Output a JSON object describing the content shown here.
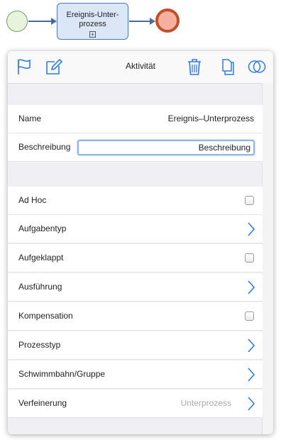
{
  "diagram": {
    "subprocess_label": "Ereignis-Unter-\nprozess",
    "subprocess_marker": "+"
  },
  "header": {
    "title": "Aktivität",
    "icons": [
      "flag-icon",
      "edit-icon",
      "trash-icon",
      "copy-icon",
      "circles-icon"
    ]
  },
  "colors": {
    "accent": "#2f7be0",
    "start_event_fill": "#e8f2dd",
    "end_event_stroke": "#c0502a",
    "task_fill": "#dbe7f7"
  },
  "fields": {
    "name_label": "Name",
    "name_value": "Ereignis–Unterprozess",
    "description_label": "Beschreibung",
    "description_value": "Beschreibung"
  },
  "properties": {
    "ad_hoc": {
      "label": "Ad Hoc",
      "checked": false
    },
    "task_type": {
      "label": "Aufgabentyp"
    },
    "expanded": {
      "label": "Aufgeklappt",
      "checked": false
    },
    "execution": {
      "label": "Ausführung"
    },
    "compensation": {
      "label": "Kompensation",
      "checked": false
    },
    "process_type": {
      "label": "Prozesstyp"
    },
    "lane": {
      "label": "Schwimmbahn/Gruppe"
    },
    "refinement": {
      "label": "Verfeinerung",
      "value": "Unterprozess"
    }
  }
}
